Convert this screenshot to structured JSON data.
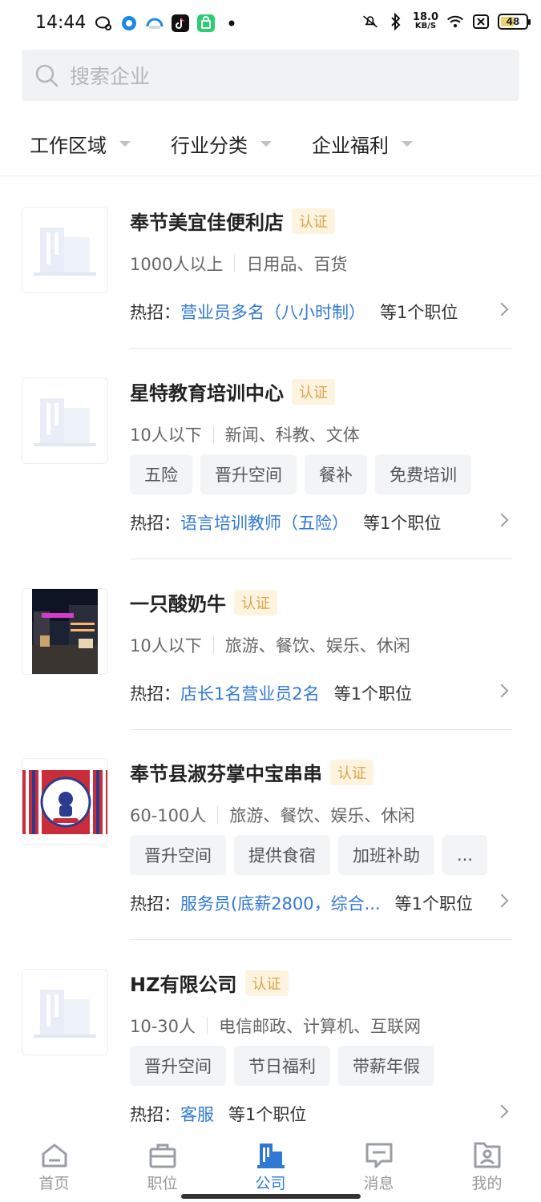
{
  "status_bar": {
    "time": "14:44",
    "net_speed_value": "18.0",
    "net_speed_unit": "KB/S",
    "battery": "48"
  },
  "search": {
    "placeholder": "搜索企业"
  },
  "filters": [
    {
      "label": "工作区域"
    },
    {
      "label": "行业分类"
    },
    {
      "label": "企业福利"
    }
  ],
  "companies": [
    {
      "name": "奉节美宜佳便利店",
      "badge": "认证",
      "size": "1000人以上",
      "industry": "日用品、百货",
      "tags": [],
      "hot_prefix": "热招：",
      "hot_job": "营业员多名（八小时制）",
      "hot_suffix": "等1个职位",
      "logo": "placeholder"
    },
    {
      "name": "星特教育培训中心",
      "badge": "认证",
      "size": "10人以下",
      "industry": "新闻、科教、文体",
      "tags": [
        "五险",
        "晋升空间",
        "餐补",
        "免费培训"
      ],
      "hot_prefix": "热招：",
      "hot_job": "语言培训教师（五险）",
      "hot_suffix": "等1个职位",
      "logo": "placeholder"
    },
    {
      "name": "一只酸奶牛",
      "badge": "认证",
      "size": "10人以下",
      "industry": "旅游、餐饮、娱乐、休闲",
      "tags": [],
      "hot_prefix": "热招：",
      "hot_job": "店长1名营业员2名",
      "hot_suffix": "等1个职位",
      "logo": "photo"
    },
    {
      "name": "奉节县淑芬掌中宝串串",
      "badge": "认证",
      "size": "60-100人",
      "industry": "旅游、餐饮、娱乐、休闲",
      "tags": [
        "晋升空间",
        "提供食宿",
        "加班补助",
        "..."
      ],
      "hot_prefix": "热招：",
      "hot_job": "服务员(底薪2800，综合...",
      "hot_suffix": "等1个职位",
      "logo": "brand"
    },
    {
      "name": "HZ有限公司",
      "badge": "认证",
      "size": "10-30人",
      "industry": "电信邮政、计算机、互联网",
      "tags": [
        "晋升空间",
        "节日福利",
        "带薪年假"
      ],
      "hot_prefix": "热招：",
      "hot_job": "客服",
      "hot_suffix": "等1个职位",
      "logo": "placeholder"
    }
  ],
  "bottom_nav": [
    {
      "label": "首页",
      "icon": "home-icon",
      "active": false
    },
    {
      "label": "职位",
      "icon": "briefcase-icon",
      "active": false
    },
    {
      "label": "公司",
      "icon": "building-icon",
      "active": true
    },
    {
      "label": "消息",
      "icon": "message-icon",
      "active": false
    },
    {
      "label": "我的",
      "icon": "profile-icon",
      "active": false
    }
  ],
  "colors": {
    "accent": "#2f78d6",
    "badge_bg": "#fdf3df",
    "badge_text": "#d8a54a"
  }
}
